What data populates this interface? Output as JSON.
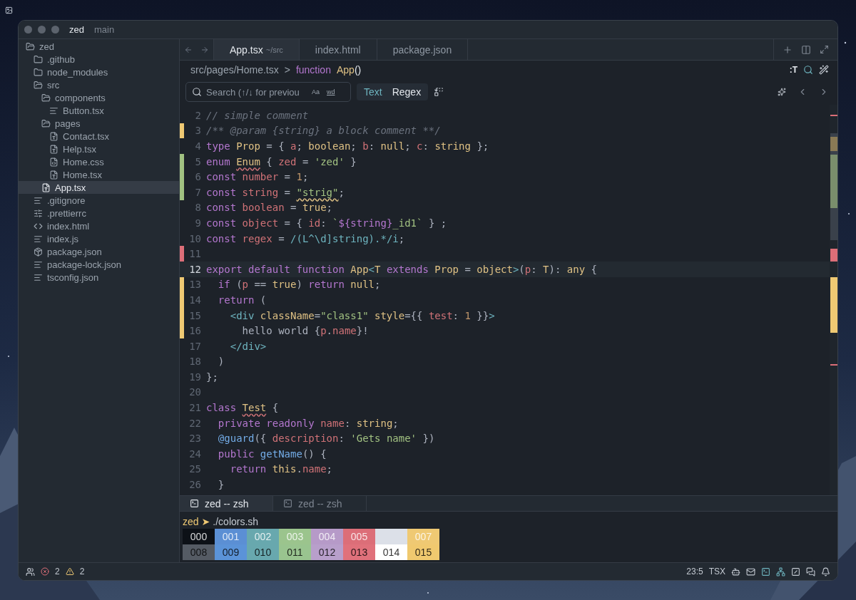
{
  "window": {
    "title": "zed",
    "branch": "main"
  },
  "project_panel": {
    "items": [
      {
        "name": "zed",
        "kind": "folder",
        "expanded": true,
        "selected": false,
        "children": [
          {
            "name": ".github",
            "kind": "folder",
            "expanded": false,
            "selected": false
          },
          {
            "name": "node_modules",
            "kind": "folder",
            "expanded": false,
            "selected": false
          },
          {
            "name": "src",
            "kind": "folder",
            "expanded": true,
            "selected": false,
            "children": [
              {
                "name": "components",
                "kind": "folder",
                "expanded": true,
                "selected": false,
                "children": [
                  {
                    "name": "Button.tsx",
                    "kind": "text",
                    "selected": false
                  }
                ]
              },
              {
                "name": "pages",
                "kind": "folder",
                "expanded": true,
                "selected": false,
                "children": [
                  {
                    "name": "Contact.tsx",
                    "kind": "ts",
                    "selected": false
                  },
                  {
                    "name": "Help.tsx",
                    "kind": "ts",
                    "selected": false
                  },
                  {
                    "name": "Home.css",
                    "kind": "css",
                    "selected": false
                  },
                  {
                    "name": "Home.tsx",
                    "kind": "ts",
                    "selected": false
                  }
                ]
              },
              {
                "name": "App.tsx",
                "kind": "ts",
                "selected": true
              }
            ]
          },
          {
            "name": ".gitignore",
            "kind": "text",
            "selected": false
          },
          {
            "name": ".prettierrc",
            "kind": "config",
            "selected": false
          },
          {
            "name": "index.html",
            "kind": "html",
            "selected": false
          },
          {
            "name": "index.js",
            "kind": "text",
            "selected": false
          },
          {
            "name": "package.json",
            "kind": "package",
            "selected": false
          },
          {
            "name": "package-lock.json",
            "kind": "text",
            "selected": false
          },
          {
            "name": "tsconfig.json",
            "kind": "text",
            "selected": false
          }
        ]
      }
    ]
  },
  "tabs": [
    {
      "label": "App.tsx",
      "detail": "~/src",
      "selected": true
    },
    {
      "label": "index.html",
      "selected": false
    },
    {
      "label": "package.json",
      "selected": false
    }
  ],
  "breadcrumb": {
    "path": "src/pages/Home.tsx",
    "separator": ">",
    "symbol_kind": "function",
    "symbol": "App",
    "symbol_suffix": "()"
  },
  "toolbar": {
    "label": ":T"
  },
  "search": {
    "placeholder": "Search (↑/↓ for previou",
    "case_toggle": "Aa",
    "word_toggle": "wd",
    "modes": [
      {
        "label": "Text",
        "selected": true
      },
      {
        "label": "Regex",
        "selected": false
      }
    ]
  },
  "editor": {
    "lines": [
      {
        "number": "2",
        "kind": "plain",
        "current": false,
        "tokens": [
          {
            "kind": "comment",
            "text": "// simple comment"
          }
        ]
      },
      {
        "number": "3",
        "kind": "modified",
        "current": false,
        "tokens": [
          {
            "kind": "comment",
            "text": "/** @param {string} a block comment **/"
          }
        ]
      },
      {
        "number": "4",
        "kind": "plain",
        "current": false,
        "tokens": [
          {
            "kind": "keyword",
            "text": "type "
          },
          {
            "kind": "type",
            "text": "Prop"
          },
          {
            "kind": "punctuation",
            "text": " = { "
          },
          {
            "kind": "variable",
            "text": "a"
          },
          {
            "kind": "punctuation",
            "text": "; "
          },
          {
            "kind": "type",
            "text": "boolean"
          },
          {
            "kind": "punctuation",
            "text": "; "
          },
          {
            "kind": "variable",
            "text": "b"
          },
          {
            "kind": "punctuation",
            "text": ": "
          },
          {
            "kind": "type",
            "text": "null"
          },
          {
            "kind": "punctuation",
            "text": "; "
          },
          {
            "kind": "variable",
            "text": "c"
          },
          {
            "kind": "punctuation",
            "text": ": "
          },
          {
            "kind": "type",
            "text": "string"
          },
          {
            "kind": "punctuation",
            "text": " };"
          }
        ]
      },
      {
        "number": "5",
        "kind": "added",
        "current": false,
        "tokens": [
          {
            "kind": "keyword",
            "text": "enum "
          },
          {
            "kind": "type",
            "text": "Enum",
            "error": true
          },
          {
            "kind": "punctuation",
            "text": " { "
          },
          {
            "kind": "variable",
            "text": "zed"
          },
          {
            "kind": "punctuation",
            "text": " = "
          },
          {
            "kind": "string",
            "text": "'zed'"
          },
          {
            "kind": "punctuation",
            "text": " }"
          }
        ]
      },
      {
        "number": "6",
        "kind": "added",
        "current": false,
        "tokens": [
          {
            "kind": "keyword",
            "text": "const "
          },
          {
            "kind": "variable",
            "text": "number"
          },
          {
            "kind": "punctuation",
            "text": " = "
          },
          {
            "kind": "number",
            "text": "1"
          },
          {
            "kind": "punctuation",
            "text": ";"
          }
        ]
      },
      {
        "number": "7",
        "kind": "added",
        "current": false,
        "tokens": [
          {
            "kind": "keyword",
            "text": "const "
          },
          {
            "kind": "variable",
            "text": "string"
          },
          {
            "kind": "punctuation",
            "text": " = "
          },
          {
            "kind": "string",
            "text": "\"strig\"",
            "warning": true
          },
          {
            "kind": "punctuation",
            "text": ";"
          }
        ]
      },
      {
        "number": "8",
        "kind": "plain",
        "current": false,
        "tokens": [
          {
            "kind": "keyword",
            "text": "const "
          },
          {
            "kind": "variable",
            "text": "boolean"
          },
          {
            "kind": "punctuation",
            "text": " = "
          },
          {
            "kind": "type",
            "text": "true"
          },
          {
            "kind": "punctuation",
            "text": ";"
          }
        ]
      },
      {
        "number": "9",
        "kind": "plain",
        "current": false,
        "tokens": [
          {
            "kind": "keyword",
            "text": "const "
          },
          {
            "kind": "variable",
            "text": "object"
          },
          {
            "kind": "punctuation",
            "text": " = { "
          },
          {
            "kind": "variable",
            "text": "id"
          },
          {
            "kind": "punctuation",
            "text": ": "
          },
          {
            "kind": "string",
            "text": "`"
          },
          {
            "kind": "keyword",
            "text": "${string}"
          },
          {
            "kind": "string",
            "text": "_id1`"
          },
          {
            "kind": "punctuation",
            "text": " } ;"
          }
        ]
      },
      {
        "number": "10",
        "kind": "plain",
        "current": false,
        "tokens": [
          {
            "kind": "keyword",
            "text": "const "
          },
          {
            "kind": "variable",
            "text": "regex"
          },
          {
            "kind": "punctuation",
            "text": " = "
          },
          {
            "kind": "regex",
            "text": "/(L^\\d]string).*/i"
          },
          {
            "kind": "punctuation",
            "text": ";"
          }
        ]
      },
      {
        "number": "11",
        "kind": "deleted",
        "current": false
      },
      {
        "number": "12",
        "kind": "plain",
        "current": true,
        "tokens": [
          {
            "kind": "keyword",
            "text": "export default function "
          },
          {
            "kind": "type",
            "text": "App"
          },
          {
            "kind": "regex",
            "text": "<"
          },
          {
            "kind": "type",
            "text": "T "
          },
          {
            "kind": "keyword",
            "text": "extends "
          },
          {
            "kind": "type",
            "text": "Prop"
          },
          {
            "kind": "punctuation",
            "text": " = "
          },
          {
            "kind": "type",
            "text": "object"
          },
          {
            "kind": "regex",
            "text": ">"
          },
          {
            "kind": "punctuation",
            "text": "("
          },
          {
            "kind": "variable",
            "text": "p"
          },
          {
            "kind": "punctuation",
            "text": ": "
          },
          {
            "kind": "type",
            "text": "T"
          },
          {
            "kind": "punctuation",
            "text": "): "
          },
          {
            "kind": "type",
            "text": "any"
          },
          {
            "kind": "punctuation",
            "text": " {"
          }
        ]
      },
      {
        "number": "13",
        "kind": "modified",
        "current": false,
        "tokens": [
          {
            "kind": "keyword",
            "text": "  if"
          },
          {
            "kind": "punctuation",
            "text": " ("
          },
          {
            "kind": "variable",
            "text": "p"
          },
          {
            "kind": "punctuation",
            "text": " == "
          },
          {
            "kind": "type",
            "text": "true"
          },
          {
            "kind": "punctuation",
            "text": ") "
          },
          {
            "kind": "keyword",
            "text": "return "
          },
          {
            "kind": "type",
            "text": "null"
          },
          {
            "kind": "punctuation",
            "text": ";"
          }
        ]
      },
      {
        "number": "14",
        "kind": "modified",
        "current": false,
        "tokens": [
          {
            "kind": "keyword",
            "text": "  return"
          },
          {
            "kind": "punctuation",
            "text": " ("
          }
        ]
      },
      {
        "number": "15",
        "kind": "modified",
        "current": false,
        "tokens": [
          {
            "kind": "tag",
            "text": "    <div "
          },
          {
            "kind": "attribute",
            "text": "className"
          },
          {
            "kind": "punctuation",
            "text": "="
          },
          {
            "kind": "string",
            "text": "\"class1\" "
          },
          {
            "kind": "attribute",
            "text": "style"
          },
          {
            "kind": "punctuation",
            "text": "={{ "
          },
          {
            "kind": "variable",
            "text": "test"
          },
          {
            "kind": "punctuation",
            "text": ": "
          },
          {
            "kind": "number",
            "text": "1"
          },
          {
            "kind": "punctuation",
            "text": " }}"
          },
          {
            "kind": "tag",
            "text": ">"
          }
        ]
      },
      {
        "number": "16",
        "kind": "modified",
        "current": false,
        "tokens": [
          {
            "kind": "punctuation",
            "text": "      hello world {"
          },
          {
            "kind": "variable",
            "text": "p"
          },
          {
            "kind": "punctuation",
            "text": "."
          },
          {
            "kind": "variable",
            "text": "name"
          },
          {
            "kind": "punctuation",
            "text": "}!"
          }
        ]
      },
      {
        "number": "17",
        "kind": "plain",
        "current": false,
        "tokens": [
          {
            "kind": "tag",
            "text": "    </div>"
          }
        ]
      },
      {
        "number": "18",
        "kind": "plain",
        "current": false,
        "tokens": [
          {
            "kind": "punctuation",
            "text": "  )"
          }
        ]
      },
      {
        "number": "19",
        "kind": "plain",
        "current": false,
        "tokens": [
          {
            "kind": "punctuation",
            "text": "};"
          }
        ]
      },
      {
        "number": "20",
        "kind": "plain",
        "current": false
      },
      {
        "number": "21",
        "kind": "plain",
        "current": false,
        "tokens": [
          {
            "kind": "keyword",
            "text": "class "
          },
          {
            "kind": "type",
            "text": "Test",
            "error": true
          },
          {
            "kind": "punctuation",
            "text": " {"
          }
        ]
      },
      {
        "number": "22",
        "kind": "plain",
        "current": false,
        "tokens": [
          {
            "kind": "keyword",
            "text": "  private readonly "
          },
          {
            "kind": "variable",
            "text": "name"
          },
          {
            "kind": "punctuation",
            "text": ": "
          },
          {
            "kind": "type",
            "text": "string"
          },
          {
            "kind": "punctuation",
            "text": ";"
          }
        ]
      },
      {
        "number": "23",
        "kind": "plain",
        "current": false,
        "tokens": [
          {
            "kind": "function",
            "text": "  @guard"
          },
          {
            "kind": "punctuation",
            "text": "({ "
          },
          {
            "kind": "variable",
            "text": "description"
          },
          {
            "kind": "punctuation",
            "text": ": "
          },
          {
            "kind": "string",
            "text": "'Gets name'"
          },
          {
            "kind": "punctuation",
            "text": " })"
          }
        ]
      },
      {
        "number": "24",
        "kind": "plain",
        "current": false,
        "tokens": [
          {
            "kind": "keyword",
            "text": "  public "
          },
          {
            "kind": "function",
            "text": "getName"
          },
          {
            "kind": "punctuation",
            "text": "() {"
          }
        ]
      },
      {
        "number": "25",
        "kind": "plain",
        "current": false,
        "tokens": [
          {
            "kind": "keyword",
            "text": "    return "
          },
          {
            "kind": "type",
            "text": "this"
          },
          {
            "kind": "punctuation",
            "text": "."
          },
          {
            "kind": "variable",
            "text": "name"
          },
          {
            "kind": "punctuation",
            "text": ";"
          }
        ]
      },
      {
        "number": "26",
        "kind": "plain",
        "current": false,
        "tokens": [
          {
            "kind": "punctuation",
            "text": "  }"
          }
        ]
      }
    ]
  },
  "terminal": {
    "tabs": [
      {
        "label": "zed -- zsh",
        "selected": true
      },
      {
        "label": "zed -- zsh",
        "selected": false
      }
    ],
    "prompt": {
      "dir": "zed",
      "arrow": "➤",
      "command": "./colors.sh"
    },
    "colors": [
      {
        "label": "000",
        "color": "#0d1117"
      },
      {
        "label": "001",
        "color": "#5b8fd4"
      },
      {
        "label": "002",
        "color": "#68a8ae"
      },
      {
        "label": "003",
        "color": "#9bc48d"
      },
      {
        "label": "004",
        "color": "#b69ac8"
      },
      {
        "label": "005",
        "color": "#dc6e78"
      },
      {
        "color": "#dce0e8"
      },
      {
        "label": "007",
        "color": "#efc973"
      },
      {
        "label": "008",
        "color": "#555b64"
      },
      {
        "label": "009",
        "color": "#5b93d8"
      },
      {
        "label": "010",
        "color": "#68a8ae"
      },
      {
        "label": "011",
        "color": "#99c48f"
      },
      {
        "label": "012",
        "color": "#b89fcb"
      },
      {
        "label": "013",
        "color": "#e0717b"
      },
      {
        "label": "014",
        "color": "#ffffff"
      },
      {
        "label": "015",
        "color": "#f0c96f"
      }
    ]
  },
  "status_bar": {
    "errors": "2",
    "warnings": "2",
    "cursor": "23:5",
    "language": "TSX"
  }
}
